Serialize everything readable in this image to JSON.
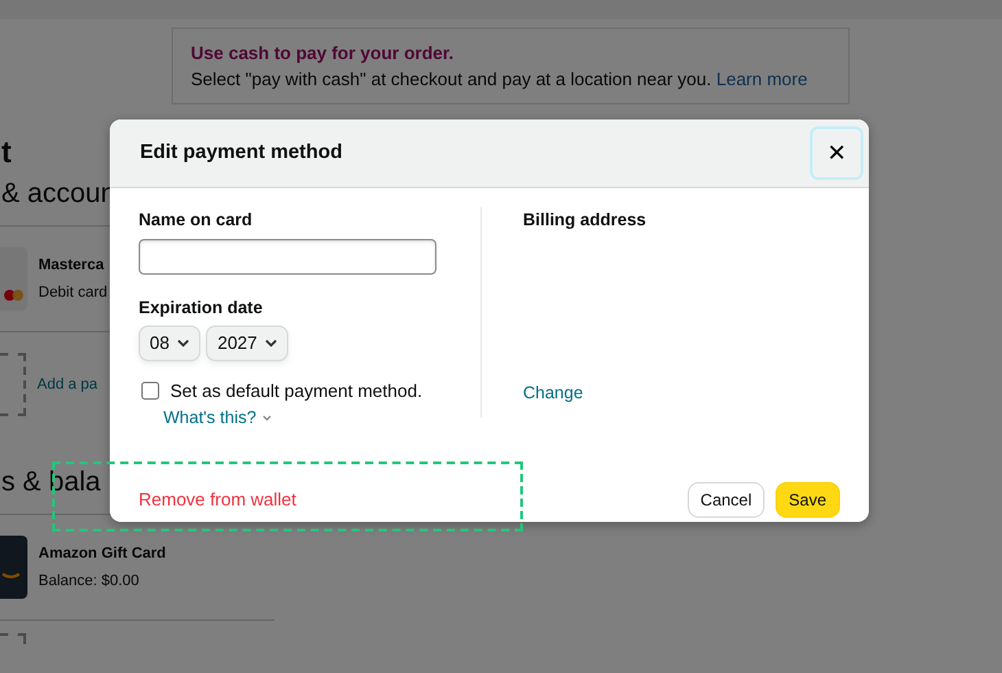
{
  "page": {
    "banner": {
      "title": "Use cash to pay for your order.",
      "text": "Select \"pay with cash\" at checkout and pay at a location near you.",
      "link": "Learn more"
    },
    "heading": "t",
    "sections": [
      {
        "heading": "& accoun",
        "items": [
          {
            "kind": "card",
            "title": "Masterca",
            "subtitle": "Debit card"
          },
          {
            "kind": "add",
            "title": "Add a pa"
          }
        ]
      },
      {
        "heading": "s & bala",
        "items": [
          {
            "kind": "gift",
            "title": "Amazon Gift Card",
            "subtitle": "Balance: $0.00"
          },
          {
            "kind": "add"
          }
        ]
      }
    ]
  },
  "dialog": {
    "title": "Edit payment method",
    "close": "✕",
    "name_label": "Name on card",
    "expiration_label": "Expiration date",
    "month": "08",
    "year": "2027",
    "default_checkbox": {
      "label": "Set as default payment method.",
      "checked": false
    },
    "whats_this": "What's this?",
    "billing_label": "Billing address",
    "change_link": "Change",
    "remove_link": "Remove from wallet",
    "buttons": [
      {
        "label": "Cancel",
        "kind": "secondary"
      },
      {
        "label": "Save",
        "kind": "primary"
      }
    ]
  }
}
